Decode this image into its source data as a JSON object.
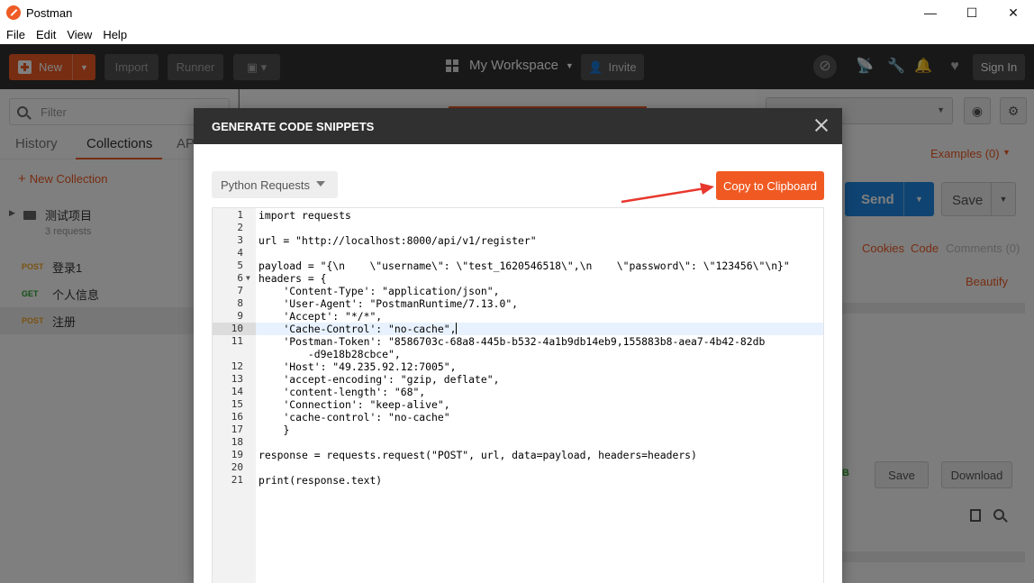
{
  "window": {
    "title": "Postman",
    "minimize": "—",
    "maximize": "☐",
    "close": "✕"
  },
  "menu": [
    "File",
    "Edit",
    "View",
    "Help"
  ],
  "header": {
    "new_label": "New",
    "import_label": "Import",
    "runner_label": "Runner",
    "workspace_label": "My Workspace",
    "invite_label": "Invite",
    "signin_label": "Sign In"
  },
  "sidebar": {
    "filter_placeholder": "Filter",
    "tabs": [
      "History",
      "Collections",
      "AP"
    ],
    "new_collection": "New Collection",
    "collection": {
      "name": "测试项目",
      "count": "3 requests"
    },
    "requests": [
      {
        "method": "POST",
        "name": "登录1",
        "color": "#f5a623"
      },
      {
        "method": "GET",
        "name": "个人信息",
        "color": "#2ca02c"
      },
      {
        "method": "POST",
        "name": "注册",
        "color": "#f5a623"
      }
    ]
  },
  "right": {
    "examples": "Examples (0)",
    "send": "Send",
    "save": "Save",
    "cookies": "Cookies",
    "code": "Code",
    "comments": "Comments (0)",
    "beautify": "Beautify",
    "save_response": "Save",
    "download": "Download",
    "partial_b": "B"
  },
  "modal": {
    "title": "GENERATE CODE SNIPPETS",
    "language": "Python Requests",
    "copy_label": "Copy to Clipboard",
    "lines": [
      {
        "n": "1",
        "text": "import requests"
      },
      {
        "n": "2",
        "text": ""
      },
      {
        "n": "3",
        "text": "url = \"http://localhost:8000/api/v1/register\""
      },
      {
        "n": "4",
        "text": ""
      },
      {
        "n": "5",
        "text": "payload = \"{\\n    \\\"username\\\": \\\"test_1620546518\\\",\\n    \\\"password\\\": \\\"123456\\\"\\n}\""
      },
      {
        "n": "6",
        "text": "headers = {",
        "fold": true
      },
      {
        "n": "7",
        "text": "    'Content-Type': \"application/json\","
      },
      {
        "n": "8",
        "text": "    'User-Agent': \"PostmanRuntime/7.13.0\","
      },
      {
        "n": "9",
        "text": "    'Accept': \"*/*\","
      },
      {
        "n": "10",
        "text": "    'Cache-Control': \"no-cache\",",
        "active": true
      },
      {
        "n": "11",
        "text": "    'Postman-Token': \"8586703c-68a8-445b-b532-4a1b9db14eb9,155883b8-aea7-4b42-82db\n        -d9e18b28cbce\",",
        "wrap": true
      },
      {
        "n": "12",
        "text": "    'Host': \"49.235.92.12:7005\","
      },
      {
        "n": "13",
        "text": "    'accept-encoding': \"gzip, deflate\","
      },
      {
        "n": "14",
        "text": "    'content-length': \"68\","
      },
      {
        "n": "15",
        "text": "    'Connection': \"keep-alive\","
      },
      {
        "n": "16",
        "text": "    'cache-control': \"no-cache\""
      },
      {
        "n": "17",
        "text": "    }"
      },
      {
        "n": "18",
        "text": ""
      },
      {
        "n": "19",
        "text": "response = requests.request(\"POST\", url, data=payload, headers=headers)"
      },
      {
        "n": "20",
        "text": ""
      },
      {
        "n": "21",
        "text": "print(response.text)"
      }
    ]
  },
  "colors": {
    "accent": "#ef5b25",
    "copy_button": "#f05a22",
    "send_button": "#1e88e5",
    "header_bg": "#303030"
  }
}
